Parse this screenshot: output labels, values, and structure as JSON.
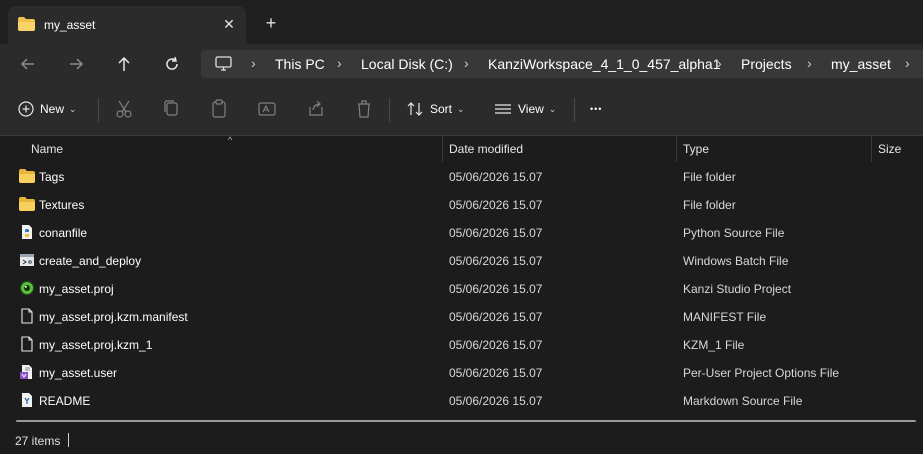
{
  "window": {
    "tab_title": "my_asset",
    "tab_close_glyph": "✕",
    "new_tab_glyph": "+"
  },
  "address": {
    "breadcrumbs": [
      "This PC",
      "Local Disk (C:)",
      "KanziWorkspace_4_1_0_457_alpha1",
      "Projects",
      "my_asset"
    ],
    "separator": "›"
  },
  "toolbar": {
    "new_label": "New",
    "sort_label": "Sort",
    "view_label": "View",
    "more_glyph": "•••"
  },
  "columns": {
    "name": "Name",
    "date": "Date modified",
    "type": "Type",
    "size": "Size"
  },
  "files": [
    {
      "name": "Tags",
      "date": "05/06/2026 15.07",
      "type": "File folder",
      "icon": "folder-icon"
    },
    {
      "name": "Textures",
      "date": "05/06/2026 15.07",
      "type": "File folder",
      "icon": "folder-icon"
    },
    {
      "name": "conanfile",
      "date": "05/06/2026 15.07",
      "type": "Python Source File",
      "icon": "python-file-icon"
    },
    {
      "name": "create_and_deploy",
      "date": "05/06/2026 15.07",
      "type": "Windows Batch File",
      "icon": "batch-file-icon"
    },
    {
      "name": "my_asset.proj",
      "date": "05/06/2026 15.07",
      "type": "Kanzi Studio Project",
      "icon": "kanzi-project-icon"
    },
    {
      "name": "my_asset.proj.kzm.manifest",
      "date": "05/06/2026 15.07",
      "type": "MANIFEST File",
      "icon": "file-icon"
    },
    {
      "name": "my_asset.proj.kzm_1",
      "date": "05/06/2026 15.07",
      "type": "KZM_1 File",
      "icon": "file-icon"
    },
    {
      "name": "my_asset.user",
      "date": "05/06/2026 15.07",
      "type": "Per-User Project Options File",
      "icon": "user-options-file-icon"
    },
    {
      "name": "README",
      "date": "05/06/2026 15.07",
      "type": "Markdown Source File",
      "icon": "markdown-file-icon"
    }
  ],
  "status": {
    "item_count": "27 items"
  },
  "colors": {
    "folder": "#f0c14b",
    "background": "#1c1c1c",
    "toolbar": "#2b2b2b"
  }
}
